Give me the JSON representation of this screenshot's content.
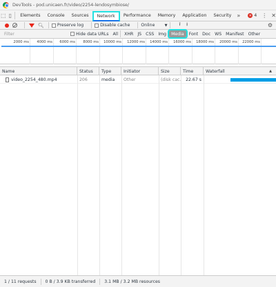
{
  "window": {
    "title": "DevTools - pod.unicaen.fr/video/2254-lendosymbiose/"
  },
  "tabs": [
    "Elements",
    "Console",
    "Sources",
    "Network",
    "Performance",
    "Memory",
    "Application",
    "Security"
  ],
  "tabs_more": "»",
  "errors": {
    "count": "4"
  },
  "toolbar": {
    "preserve_log": "Preserve log",
    "disable_cache": "Disable cache",
    "throttling": "Online"
  },
  "filterbar": {
    "placeholder": "Filter",
    "hide_data_urls": "Hide data URLs",
    "types": [
      "All",
      "XHR",
      "JS",
      "CSS",
      "Img",
      "Media",
      "Font",
      "Doc",
      "WS",
      "Manifest",
      "Other"
    ],
    "selected_type": "Media"
  },
  "overview": {
    "ticks": [
      "2000 ms",
      "4000 ms",
      "6000 ms",
      "8000 ms",
      "10000 ms",
      "12000 ms",
      "14000 ms",
      "16000 ms",
      "18000 ms",
      "20000 ms",
      "22000 ms"
    ]
  },
  "table": {
    "columns": [
      "Name",
      "Status",
      "Type",
      "Initiator",
      "Size",
      "Time",
      "Waterfall"
    ],
    "rows": [
      {
        "name": "video_2254_480.mp4",
        "status": "206",
        "type": "media",
        "initiator": "Other",
        "size": "(disk cac...",
        "time": "22.67 s"
      }
    ]
  },
  "status": {
    "requests": "1 / 11 requests",
    "transferred": "0 B / 3.9 KB transferred",
    "resources": "3.1 MB / 3.2 MB resources"
  },
  "colors": {
    "highlight": "#22e0e0",
    "record": "#e8271b",
    "waterfall": "#009ee6"
  }
}
